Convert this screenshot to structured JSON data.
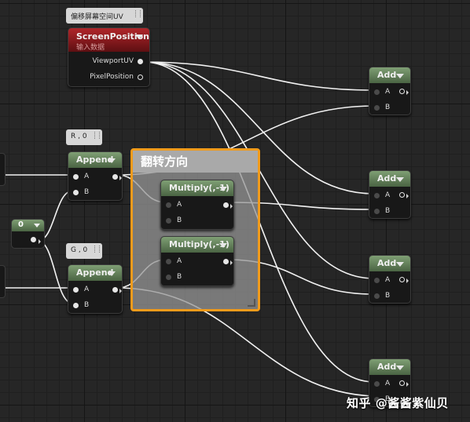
{
  "screen_position": {
    "comment": "偏移屏幕空间UV",
    "title": "ScreenPosition",
    "subtitle": "输入数据",
    "outputs": [
      "ViewportUV",
      "PixelPosition"
    ]
  },
  "append_r": {
    "comment": "R , 0",
    "title": "Append",
    "inputs": [
      "A",
      "B"
    ]
  },
  "append_g": {
    "comment": "G , 0",
    "title": "Append",
    "inputs": [
      "A",
      "B"
    ]
  },
  "constant": {
    "value": "0"
  },
  "comment_group": {
    "title": "翻转方向"
  },
  "multiply_1": {
    "title": "Multiply(,-1)",
    "inputs": [
      "A",
      "B"
    ]
  },
  "multiply_2": {
    "title": "Multiply(,-1)",
    "inputs": [
      "A",
      "B"
    ]
  },
  "add_nodes": [
    {
      "title": "Add",
      "inputs": [
        "A",
        "B"
      ]
    },
    {
      "title": "Add",
      "inputs": [
        "A",
        "B"
      ]
    },
    {
      "title": "Add",
      "inputs": [
        "A",
        "B"
      ]
    },
    {
      "title": "Add",
      "inputs": [
        "A",
        "B"
      ]
    }
  ],
  "watermark": "知乎 @酱酱紫仙贝",
  "colors": {
    "background": "#262626",
    "comment_border": "#f19b1b",
    "node_header_green": "#6a8a5f",
    "node_header_red": "#a5252a",
    "wire": "#f2f2f2"
  }
}
